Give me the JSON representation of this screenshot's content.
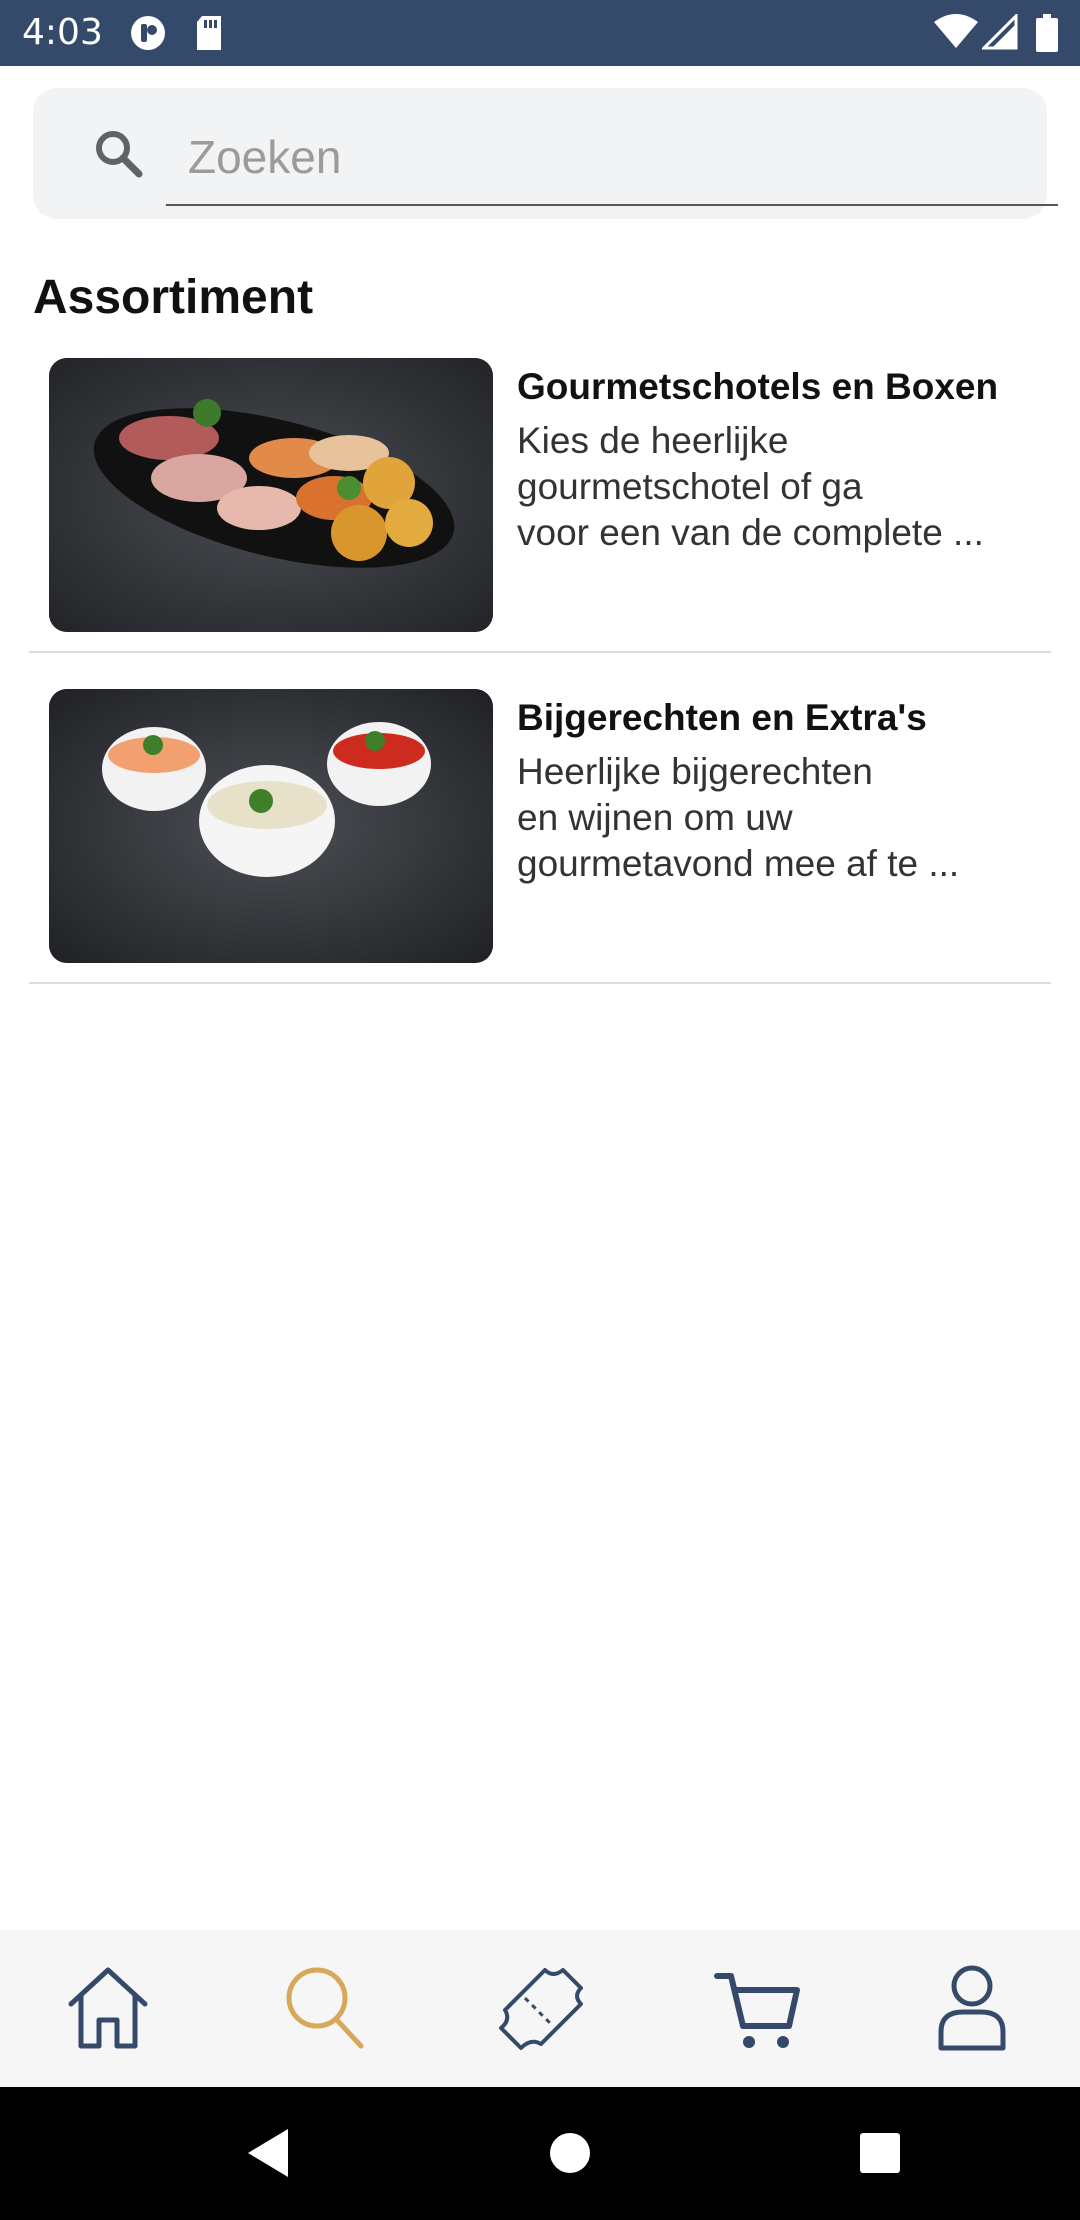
{
  "status_bar": {
    "time": "4:03",
    "icons": [
      "notification-app-icon",
      "sd-card-icon",
      "wifi-icon",
      "signal-icon",
      "battery-icon"
    ]
  },
  "search": {
    "placeholder": "Zoeken",
    "value": "",
    "icon": "search-icon"
  },
  "section": {
    "title": "Assortiment"
  },
  "products": [
    {
      "title": "Gourmetschotels en Boxen",
      "description_lines": [
        "Kies de heerlijke",
        "gourmetschotel of ga",
        "voor een van de complete ..."
      ],
      "image": "gourmet-platter-image"
    },
    {
      "title": "Bijgerechten en Extra's",
      "description_lines": [
        "Heerlijke bijgerechten",
        "en wijnen om uw",
        "gourmetavond mee af te ..."
      ],
      "image": "sauces-image"
    }
  ],
  "bottom_nav": {
    "items": [
      {
        "icon": "home-icon",
        "active": false
      },
      {
        "icon": "search-icon",
        "active": true
      },
      {
        "icon": "ticket-icon",
        "active": false
      },
      {
        "icon": "cart-icon",
        "active": false
      },
      {
        "icon": "profile-icon",
        "active": false
      }
    ]
  },
  "colors": {
    "status_bar": "#354a6a",
    "nav_icon": "#354a6a",
    "nav_active": "#d7a85a",
    "background": "#ffffff"
  }
}
